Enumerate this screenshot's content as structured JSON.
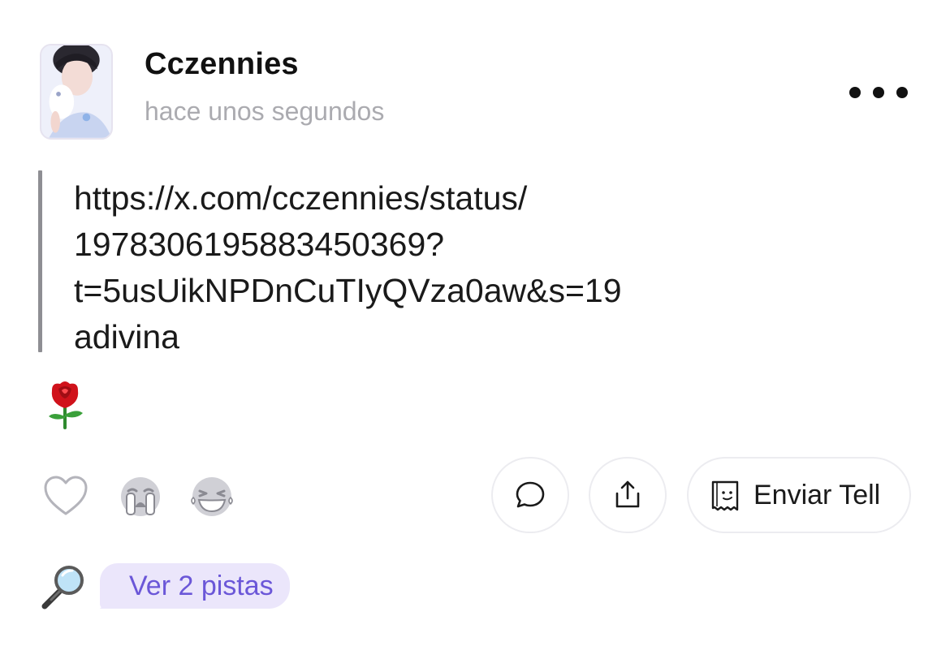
{
  "post": {
    "author": "Cczennies",
    "timestamp": "hace unos segundos",
    "quote_lines": [
      "https://x.com/cczennies/status/",
      "1978306195883450369?",
      "t=5usUikNPDnCuTIyQVza0aw&s=19",
      "adivina"
    ],
    "emoji": "rose-emoji"
  },
  "actions": {
    "reactions": [
      "heart-icon",
      "crying-face-icon",
      "laughing-face-icon"
    ],
    "send_tell_label": "Enviar Tell"
  },
  "hints": {
    "label": "Ver 2 pistas"
  },
  "colors": {
    "accent_text": "#6b57d8",
    "accent_bg": "#ebe6fb",
    "muted_text": "#ababb0",
    "quote_bar": "#8e8e93"
  }
}
